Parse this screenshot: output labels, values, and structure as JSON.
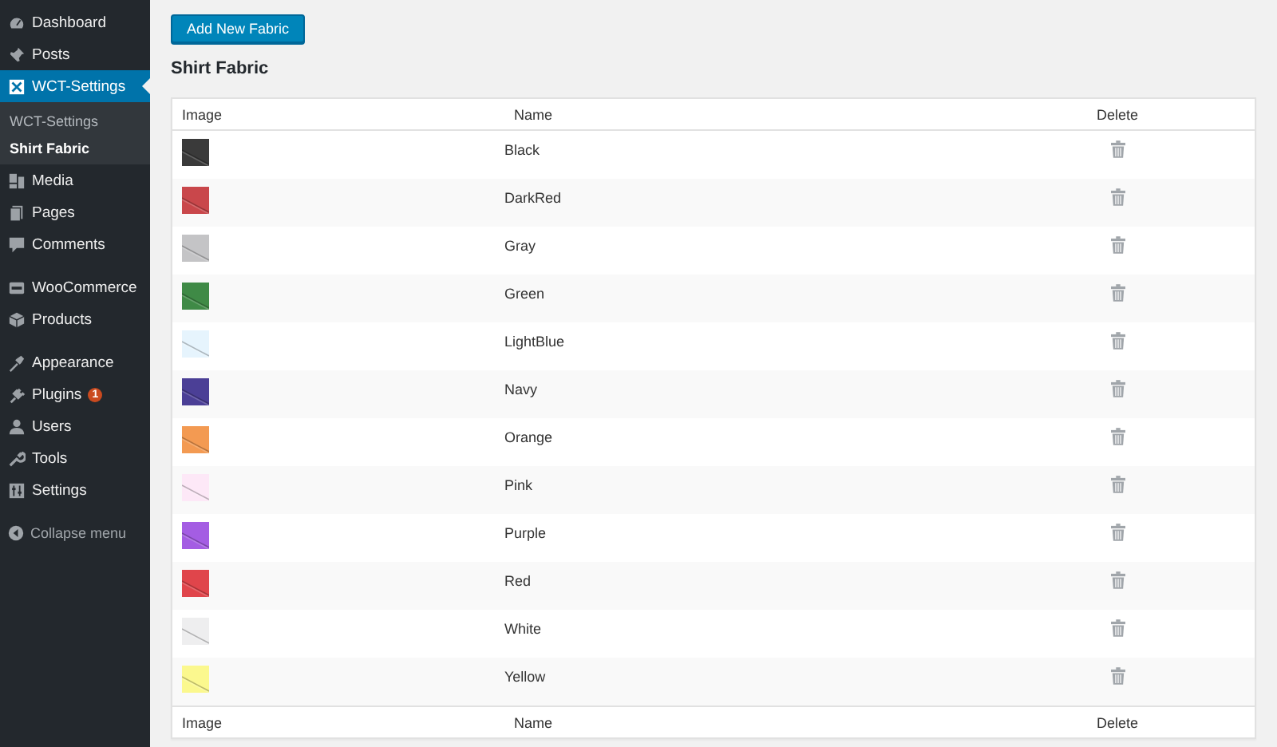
{
  "sidebar": {
    "groups": [
      {
        "items": [
          {
            "label": "Dashboard",
            "selected": false
          },
          {
            "label": "Posts",
            "selected": false
          },
          {
            "label": "WCT-Settings",
            "selected": true,
            "children": [
              {
                "label": "WCT-Settings",
                "selected": false
              },
              {
                "label": "Shirt Fabric",
                "selected": true
              }
            ]
          },
          {
            "label": "Media",
            "selected": false
          },
          {
            "label": "Pages",
            "selected": false
          },
          {
            "label": "Comments",
            "selected": false
          }
        ]
      },
      {
        "items": [
          {
            "label": "WooCommerce",
            "selected": false
          },
          {
            "label": "Products",
            "selected": false
          }
        ]
      },
      {
        "items": [
          {
            "label": "Appearance",
            "selected": false
          },
          {
            "label": "Plugins",
            "selected": false,
            "badge": "1"
          },
          {
            "label": "Users",
            "selected": false
          },
          {
            "label": "Tools",
            "selected": false
          },
          {
            "label": "Settings",
            "selected": false
          }
        ]
      }
    ],
    "collapse": "Collapse menu"
  },
  "add_button": "Add New Fabric",
  "heading": "Shirt Fabric",
  "table": {
    "columns": [
      "Image",
      "Name",
      "Delete"
    ],
    "rows": [
      {
        "name": "Black",
        "color": "#3a3a3a"
      },
      {
        "name": "DarkRed",
        "color": "#c9474b"
      },
      {
        "name": "Gray",
        "color": "#c4c4c6"
      },
      {
        "name": "Green",
        "color": "#3f8a46"
      },
      {
        "name": "LightBlue",
        "color": "#e6f4fd"
      },
      {
        "name": "Navy",
        "color": "#4b3f96"
      },
      {
        "name": "Orange",
        "color": "#f39a52"
      },
      {
        "name": "Pink",
        "color": "#fde8f7"
      },
      {
        "name": "Purple",
        "color": "#a45de3"
      },
      {
        "name": "Red",
        "color": "#e0454b"
      },
      {
        "name": "White",
        "color": "#eeeeef"
      },
      {
        "name": "Yellow",
        "color": "#fbf88e"
      }
    ],
    "footer": [
      "Image",
      "Name",
      "Delete"
    ]
  }
}
